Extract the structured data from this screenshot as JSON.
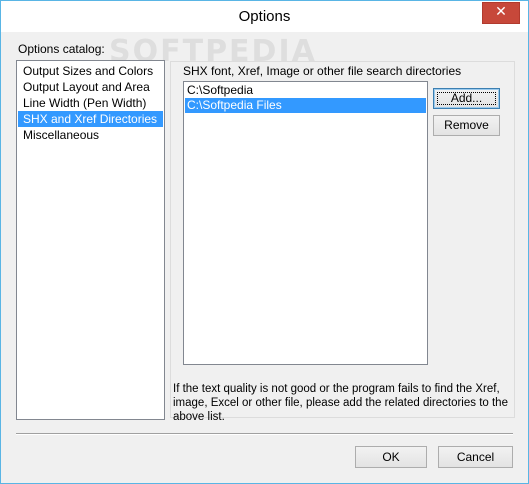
{
  "window": {
    "title": "Options",
    "close_glyph": "✕"
  },
  "watermark": "SOFTPEDIA",
  "catalog": {
    "label": "Options catalog:",
    "items": [
      {
        "label": "Output Sizes and Colors",
        "selected": false
      },
      {
        "label": "Output Layout and Area",
        "selected": false
      },
      {
        "label": "Line Width (Pen Width)",
        "selected": false
      },
      {
        "label": "SHX and Xref Directories",
        "selected": true
      },
      {
        "label": "Miscellaneous",
        "selected": false
      }
    ]
  },
  "directories": {
    "label": "SHX font, Xref, Image or other file search directories",
    "items": [
      {
        "label": "C:\\Softpedia",
        "selected": false
      },
      {
        "label": "C:\\Softpedia Files",
        "selected": true
      }
    ],
    "add_label": "Add...",
    "remove_label": "Remove",
    "hint": "If the text quality is not good or the program fails to find the Xref, image, Excel or other file, please add the related directories to the above list."
  },
  "footer": {
    "ok_label": "OK",
    "cancel_label": "Cancel"
  },
  "colors": {
    "selection": "#3399ff",
    "close_button": "#c7483a",
    "window_border": "#59b5e5"
  }
}
